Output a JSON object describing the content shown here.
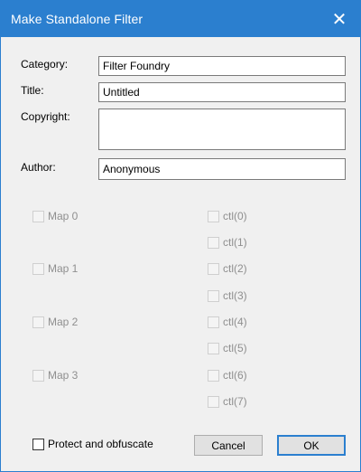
{
  "window": {
    "title": "Make Standalone Filter",
    "close_glyph": "✕"
  },
  "form": {
    "category": {
      "label": "Category:",
      "value": "Filter Foundry"
    },
    "title": {
      "label": "Title:",
      "value": "Untitled"
    },
    "copyright": {
      "label": "Copyright:",
      "value": ""
    },
    "author": {
      "label": "Author:",
      "value": "Anonymous"
    }
  },
  "maps": [
    {
      "label": "Map 0",
      "checked": false,
      "enabled": false
    },
    {
      "label": "Map 1",
      "checked": false,
      "enabled": false
    },
    {
      "label": "Map 2",
      "checked": false,
      "enabled": false
    },
    {
      "label": "Map 3",
      "checked": false,
      "enabled": false
    }
  ],
  "controls": [
    {
      "label": "ctl(0)",
      "checked": false,
      "enabled": false
    },
    {
      "label": "ctl(1)",
      "checked": false,
      "enabled": false
    },
    {
      "label": "ctl(2)",
      "checked": false,
      "enabled": false
    },
    {
      "label": "ctl(3)",
      "checked": false,
      "enabled": false
    },
    {
      "label": "ctl(4)",
      "checked": false,
      "enabled": false
    },
    {
      "label": "ctl(5)",
      "checked": false,
      "enabled": false
    },
    {
      "label": "ctl(6)",
      "checked": false,
      "enabled": false
    },
    {
      "label": "ctl(7)",
      "checked": false,
      "enabled": false
    }
  ],
  "protect": {
    "label": "Protect and obfuscate",
    "checked": false,
    "enabled": true
  },
  "buttons": {
    "cancel": "Cancel",
    "ok": "OK"
  },
  "colors": {
    "titlebar": "#2b7fcf",
    "dialog_bg": "#f0f0f0",
    "disabled_text": "#8f8f8f"
  }
}
